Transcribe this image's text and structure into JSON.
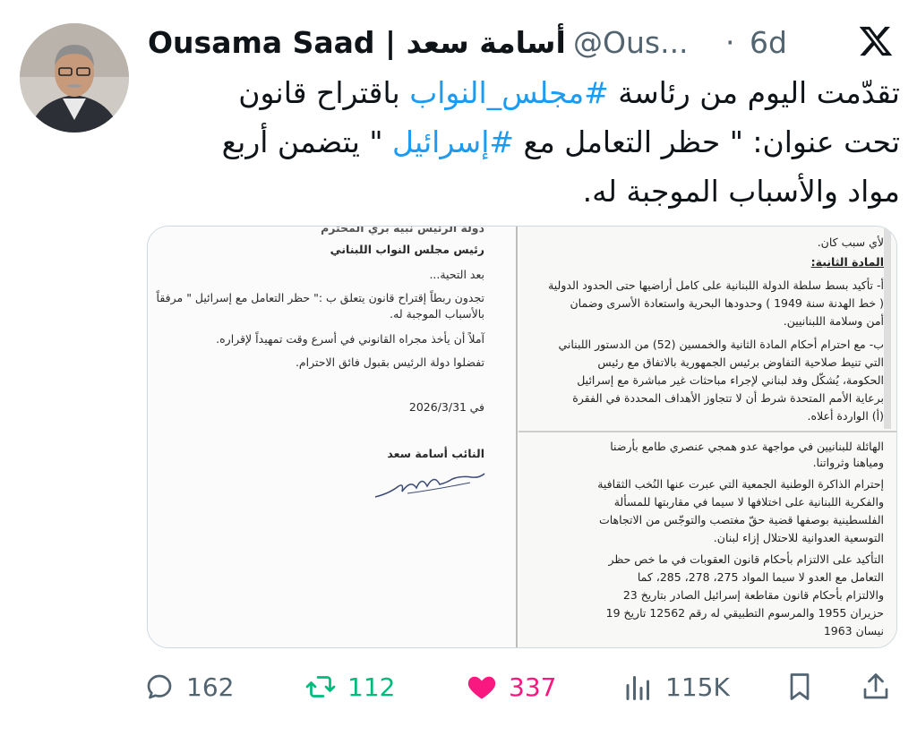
{
  "header": {
    "display_name": "Ousama Saad | أسامة سعد",
    "handle": "@Ous...",
    "separator": "·",
    "time": "6d"
  },
  "tweet": {
    "line1_a": "تقدّمت اليوم من رئاسة ",
    "line1_tag": "#مجلس_النواب",
    "line1_b": " باقتراح قانون",
    "line2_a": "تحت عنوان: \" حظر التعامل مع ",
    "line2_tag": "#إسرائيل",
    "line2_b": " \" يتضمن أربع",
    "line3": "مواد والأسباب الموجبة له."
  },
  "doc_left": {
    "l0": "دولة الرئيس نبيه بري المحترم",
    "l1": "رئيس مجلس النواب اللبناني",
    "l2": "بعد التحية...",
    "l3": "تجدون ربطاً إقتراح قانون يتعلق ب :\" حظر التعامل مع إسرائيل \" مرفقاً",
    "l4": "بالأسباب الموجبة له.",
    "l5": "آملاً أن يأخذ مجراه القانوني في أسرع وقت تمهيداً لإقراره.",
    "l6": "تفضلوا دولة الرئيس بقبول فائق الاحترام.",
    "date_prefix": "في",
    "date": "2026/3/31",
    "signatory": "النائب أسامة سعد"
  },
  "doc_right": {
    "r0": "لأي سبب كان.",
    "r1": "المادة الثانية:",
    "r2": "أ- تأكيد بسط سلطة الدولة اللبنانية على كامل أراضيها حتى الحدود الدولية",
    "r3": "( خط الهدنة سنة 1949 ) وحدودها البحرية واستعادة الأسرى وضمان",
    "r4": "أمن وسلامة اللبنانيين.",
    "r5": "ب- مع احترام أحكام المادة الثانية والخمسين (52) من الدستور اللبناني",
    "r6": "التي تنيط صلاحية التفاوض برئيس الجمهورية بالاتفاق مع رئيس",
    "r7": "الحكومة، يُشكّل وفد لبناني لإجراء مباحثات غير مباشرة مع إسرائيل",
    "r8": "برعاية الأمم المتحدة شرط أن لا تتجاوز الأهداف المحددة في الفقرة",
    "r9": "(أ) الواردة أعلاه.",
    "s0": "الهائلة للبنانيين في مواجهة عدو همجي عنصري طامع بأرضنا",
    "s1": "ومياهنا وثرواتنا.",
    "s2": "إحترام الذاكرة الوطنية الجمعية التي عبرت عنها النُخب الثقافية",
    "s3": "والفكرية اللبنانية على اختلافها لا سيما في مقاربتها للمسألة",
    "s4": "الفلسطينية بوصفها قضية حقّ مغتصب والتوجّس من الاتجاهات",
    "s5": "التوسعية العدوانية للاحتلال إزاء لبنان.",
    "s6": "التأكيد على الالتزام بأحكام قانون العقوبات في ما خص حظر",
    "s7": "التعامل مع العدو لا سيما المواد 275، 278، 285، كما",
    "s8": "والالتزام بأحكام قانون مقاطعة إسرائيل الصادر بتاريخ 23",
    "s9": "حزيران 1955 والمرسوم التطبيقي له رقم 12562 تاريخ 19",
    "s10": "نيسان 1963"
  },
  "actions": {
    "replies": "162",
    "retweets": "112",
    "likes": "337",
    "views": "115K"
  },
  "colors": {
    "link": "#1d9bf0",
    "retweet": "#00ba7c",
    "like": "#f91880",
    "muted": "#536471"
  }
}
